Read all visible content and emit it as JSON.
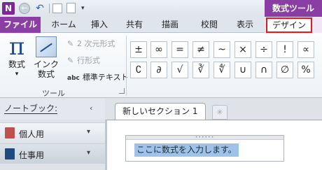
{
  "quick_access": {
    "app_icon": "N",
    "back_icon": "←",
    "undo_icon": "↶",
    "dropdown_icon": "▾"
  },
  "context_title": "数式ツール",
  "tabs": [
    {
      "label": "ファイル"
    },
    {
      "label": "ホーム"
    },
    {
      "label": "挿入"
    },
    {
      "label": "共有"
    },
    {
      "label": "描画"
    },
    {
      "label": "校閲"
    },
    {
      "label": "表示"
    },
    {
      "label": "デザイン"
    }
  ],
  "ribbon": {
    "equation_label": "数式",
    "equation_icon": "π",
    "equation_dropdown": "▾",
    "ink_label_line1": "インク",
    "ink_label_line2": "数式",
    "professional": "2 次元形式",
    "linear": "行形式",
    "normal_text_icon": "abc",
    "normal_text": "標準テキスト",
    "group_tools": "ツール",
    "symbols_row1": [
      "±",
      "∞",
      "=",
      "≠",
      "~",
      "×",
      "÷",
      "!",
      "∝"
    ],
    "symbols_row2": [
      "∁",
      "∂",
      "√",
      "∛",
      "∜",
      "∪",
      "∩",
      "∅",
      "%"
    ]
  },
  "notebooks": {
    "header": "ノートブック:",
    "collapse_icon": "‹",
    "items": [
      {
        "name": "個人用",
        "color": "#c0504d",
        "chev": "▾"
      },
      {
        "name": "仕事用",
        "color": "#1f497d",
        "chev": "▾"
      }
    ]
  },
  "section": {
    "tab_label": "新しいセクション 1",
    "new_tab_icon": "✳"
  },
  "editor": {
    "placeholder": "ここに数式を入力します。",
    "grip": "••••••"
  }
}
